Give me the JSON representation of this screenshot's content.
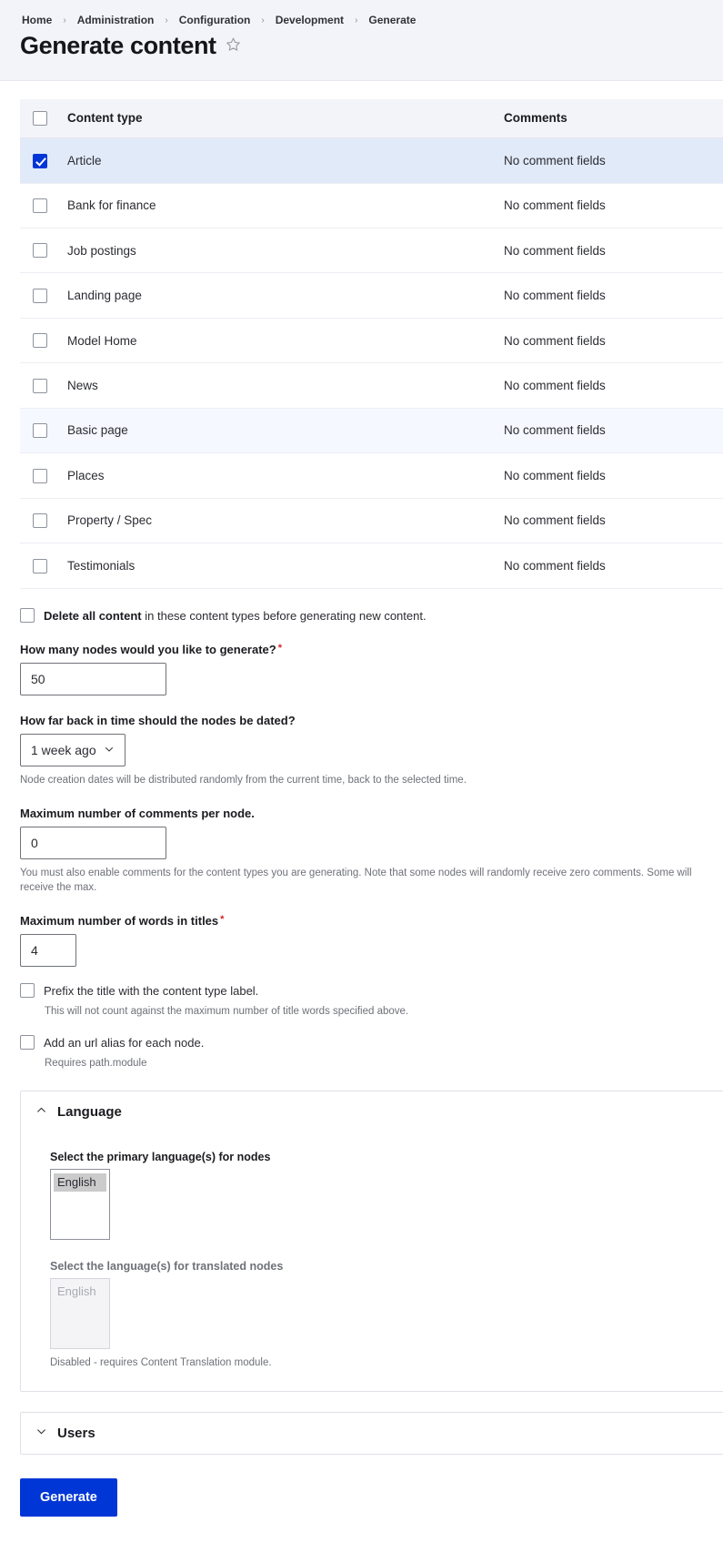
{
  "header": {
    "breadcrumb": [
      "Home",
      "Administration",
      "Configuration",
      "Development",
      "Generate"
    ],
    "separator": "›",
    "title": "Generate content",
    "star_icon": "star-outline-icon"
  },
  "table": {
    "columns": [
      "Content type",
      "Comments"
    ],
    "rows": [
      {
        "name": "Article",
        "comments": "No comment fields",
        "checked": true,
        "state": "selected"
      },
      {
        "name": "Bank for finance",
        "comments": "No comment fields",
        "checked": false,
        "state": ""
      },
      {
        "name": "Job postings",
        "comments": "No comment fields",
        "checked": false,
        "state": ""
      },
      {
        "name": "Landing page",
        "comments": "No comment fields",
        "checked": false,
        "state": ""
      },
      {
        "name": "Model Home",
        "comments": "No comment fields",
        "checked": false,
        "state": ""
      },
      {
        "name": "News",
        "comments": "No comment fields",
        "checked": false,
        "state": ""
      },
      {
        "name": "Basic page",
        "comments": "No comment fields",
        "checked": false,
        "state": "hover"
      },
      {
        "name": "Places",
        "comments": "No comment fields",
        "checked": false,
        "state": ""
      },
      {
        "name": "Property / Spec",
        "comments": "No comment fields",
        "checked": false,
        "state": ""
      },
      {
        "name": "Testimonials",
        "comments": "No comment fields",
        "checked": false,
        "state": ""
      }
    ]
  },
  "form": {
    "delete_all": {
      "strong": "Delete all content",
      "rest": " in these content types before generating new content.",
      "checked": false
    },
    "nodes_count": {
      "label": "How many nodes would you like to generate?",
      "required_marker": "*",
      "value": "50"
    },
    "time_back": {
      "label": "How far back in time should the nodes be dated?",
      "value": "1 week ago",
      "chevron": "chevron-down-icon",
      "help": "Node creation dates will be distributed randomly from the current time, back to the selected time."
    },
    "max_comments": {
      "label": "Maximum number of comments per node.",
      "value": "0",
      "help": "You must also enable comments for the content types you are generating. Note that some nodes will randomly receive zero comments. Some will receive the max."
    },
    "max_title_words": {
      "label": "Maximum number of words in titles",
      "required_marker": "*",
      "value": "4"
    },
    "prefix_title": {
      "label": "Prefix the title with the content type label.",
      "help": "This will not count against the maximum number of title words specified above.",
      "checked": false
    },
    "url_alias": {
      "label": "Add an url alias for each node.",
      "help": "Requires path.module",
      "checked": false
    }
  },
  "language_section": {
    "title": "Language",
    "toggle_icon": "chevron-up-icon",
    "expanded": true,
    "primary": {
      "label": "Select the primary language(s) for nodes",
      "options": [
        "English"
      ],
      "selected": "English"
    },
    "translated": {
      "label": "Select the language(s) for translated nodes",
      "options": [
        "English"
      ],
      "disabled": true,
      "help": "Disabled - requires Content Translation module."
    }
  },
  "users_section": {
    "title": "Users",
    "toggle_icon": "chevron-down-icon",
    "expanded": false
  },
  "submit": {
    "label": "Generate"
  },
  "colors": {
    "accent_blue": "#0036d6",
    "header_bg": "#f3f4f9",
    "row_selected": "#e1eaf9",
    "row_hover": "#f5f8fe",
    "required_red": "#d72222"
  }
}
